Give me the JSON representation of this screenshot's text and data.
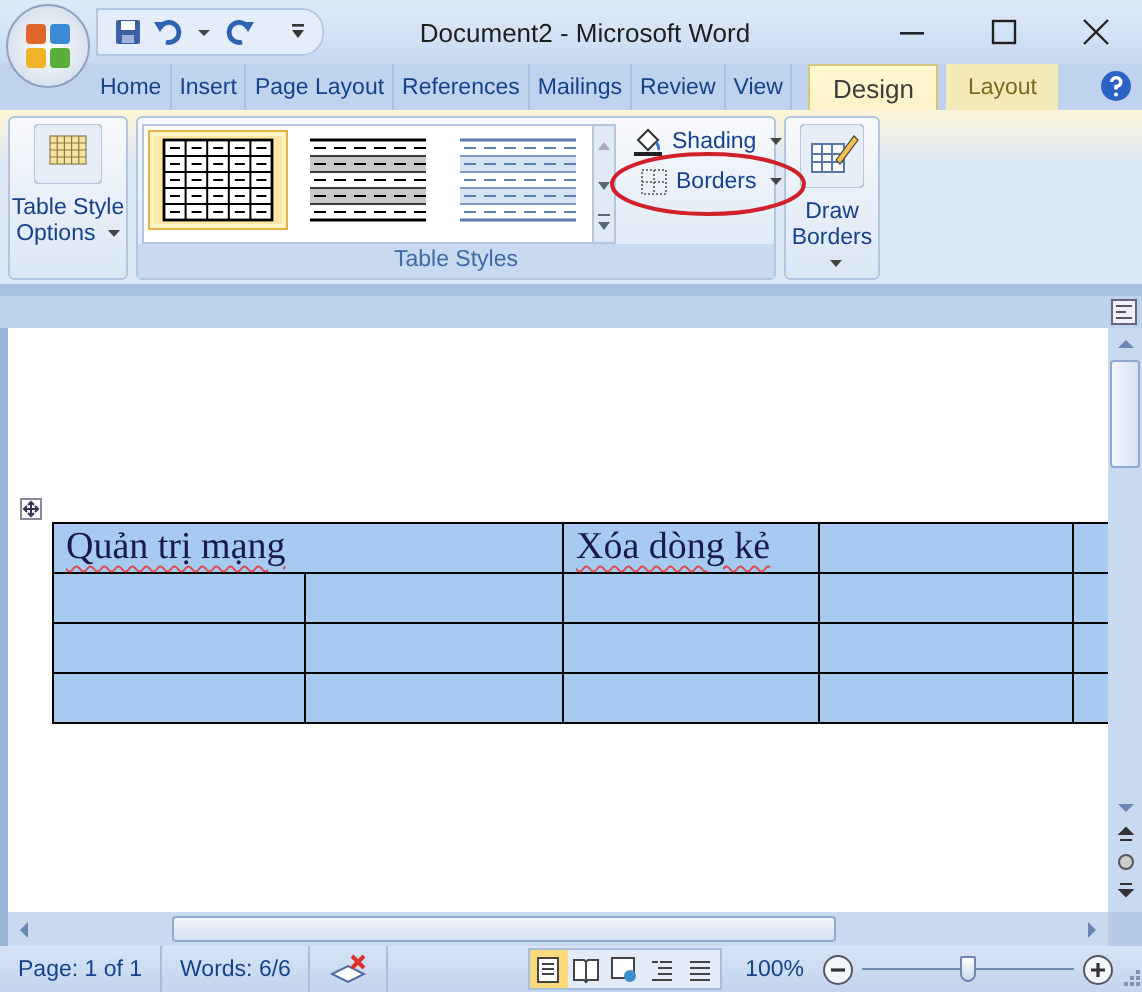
{
  "window": {
    "title": "Document2 - Microsoft Word"
  },
  "tabs": [
    {
      "label": "Home",
      "selected": false,
      "contextual": false
    },
    {
      "label": "Insert",
      "selected": false,
      "contextual": false
    },
    {
      "label": "Page Layout",
      "selected": false,
      "contextual": false
    },
    {
      "label": "References",
      "selected": false,
      "contextual": false
    },
    {
      "label": "Mailings",
      "selected": false,
      "contextual": false
    },
    {
      "label": "Review",
      "selected": false,
      "contextual": false
    },
    {
      "label": "View",
      "selected": false,
      "contextual": false
    },
    {
      "label": "Design",
      "selected": true,
      "contextual": true
    },
    {
      "label": "Layout",
      "selected": false,
      "contextual": true
    }
  ],
  "ribbon": {
    "table_style_options": {
      "label": "Table Style Options"
    },
    "table_styles": {
      "group_label": "Table Styles",
      "styles": [
        {
          "kind": "grid",
          "selected": true
        },
        {
          "kind": "banded-gray",
          "selected": false
        },
        {
          "kind": "banded-blue",
          "selected": false
        }
      ],
      "shading": "Shading",
      "borders": {
        "label": "Borders",
        "highlighted": true
      }
    },
    "draw_borders": {
      "label": "Draw Borders"
    }
  },
  "table": {
    "selected": true,
    "rows": [
      {
        "cells": [
          {
            "text": "Quản trị mạng",
            "misspelled": true,
            "colspan": 2
          },
          {
            "text": "Xóa dòng kẻ",
            "misspelled": true
          },
          {},
          {}
        ]
      },
      {
        "cells": [
          {},
          {},
          {},
          {},
          {}
        ]
      },
      {
        "cells": [
          {},
          {},
          {},
          {},
          {}
        ]
      },
      {
        "cells": [
          {},
          {},
          {},
          {},
          {}
        ]
      }
    ]
  },
  "status_bar": {
    "page": "Page: 1 of 1",
    "words": "Words: 6/6",
    "views": [
      {
        "kind": "print",
        "selected": true
      },
      {
        "kind": "reading",
        "selected": false
      },
      {
        "kind": "web",
        "selected": false
      },
      {
        "kind": "outline",
        "selected": false
      },
      {
        "kind": "draft",
        "selected": false
      }
    ],
    "zoom": "100%",
    "zoom_slider": {
      "level": 0.5
    }
  }
}
